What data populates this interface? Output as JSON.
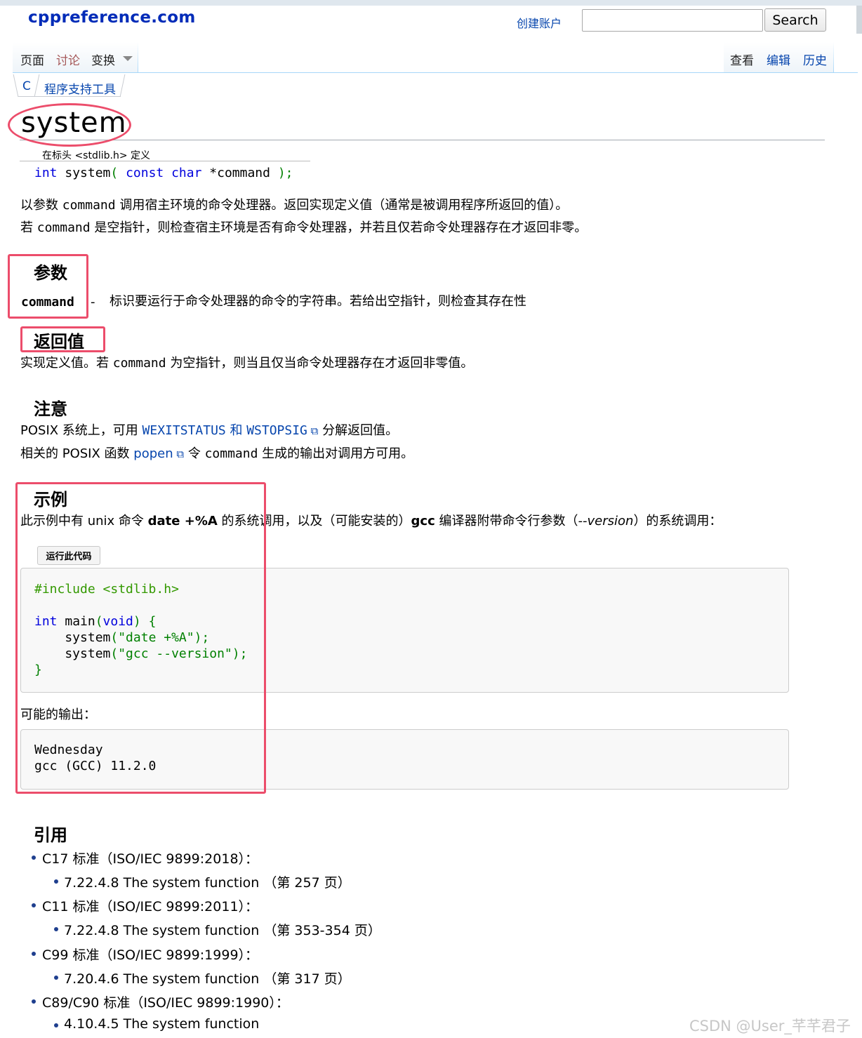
{
  "header": {
    "logo": "cppreference.com",
    "create_account": "创建账户",
    "search_placeholder": "",
    "search_button": "Search"
  },
  "tabs": {
    "page": "页面",
    "discussion": "讨论",
    "variants": "变换",
    "view": "查看",
    "edit": "编辑",
    "history": "历史"
  },
  "breadcrumb": [
    "C",
    "程序支持工具"
  ],
  "page_title": "system",
  "declaration": {
    "defined_in": "在标头 <stdlib.h> 定义",
    "tok_int": "int",
    "tok_name": " system",
    "tok_open": "( ",
    "tok_const": "const",
    "tok_sp": " ",
    "tok_char": "char",
    "tok_param": " *command ",
    "tok_close": ");"
  },
  "description": {
    "line1_a": "以参数 ",
    "line1_code": "command",
    "line1_b": " 调用宿主环境的命令处理器。返回实现定义值（通常是被调用程序所返回的值）。",
    "line2_a": "若 ",
    "line2_code": "command",
    "line2_b": " 是空指针，则检查宿主环境是否有命令处理器，并若且仅若命令处理器存在才返回非零。"
  },
  "params": {
    "heading": "参数",
    "name": "command",
    "dash": "-",
    "desc": "标识要运行于命令处理器的命令的字符串。若给出空指针，则检查其存在性"
  },
  "return_value": {
    "heading": "返回值",
    "text_a": "实现定义值。若 ",
    "text_code": "command",
    "text_b": " 为空指针，则当且仅当命令处理器存在才返回非零值。"
  },
  "notes": {
    "heading": "注意",
    "line1_a": "POSIX 系统上，可用 ",
    "line1_link1": "WEXITSTATUS",
    "line1_and": " 和 ",
    "line1_link2": "WSTOPSIG",
    "line1_b": " 分解返回值。",
    "line2_a": "相关的 POSIX 函数 ",
    "line2_link": "popen",
    "line2_b": " 令 ",
    "line2_code": "command",
    "line2_c": " 生成的输出对调用方可用。"
  },
  "example": {
    "heading": "示例",
    "intro_a": "此示例中有 unix 命令 ",
    "intro_bold1": "date +%A",
    "intro_b": " 的系统调用，以及（可能安装的）",
    "intro_bold2": "gcc",
    "intro_c": " 编译器附带命令行参数（",
    "intro_ital": "--version",
    "intro_d": "）的系统调用：",
    "run_button": "运行此代码",
    "code": {
      "include": "#include <stdlib.h>",
      "l2_int": "int",
      "l2_main": " main",
      "l2_open": "(",
      "l2_void": "void",
      "l2_close": ")",
      "l2_brace": " {",
      "l3_fn": "    system",
      "l3_open": "(",
      "l3_str": "\"date +%A\"",
      "l3_close": ");",
      "l4_fn": "    system",
      "l4_open": "(",
      "l4_str": "\"gcc --version\"",
      "l4_close": ");",
      "l5": "}"
    },
    "output_label": "可能的输出：",
    "output_lines": [
      "Wednesday",
      "gcc (GCC) 11.2.0"
    ]
  },
  "references": {
    "heading": "引用",
    "items": [
      {
        "std": "C17 标准（ISO/IEC 9899:2018）：",
        "sub": "7.22.4.8 The system function （第 257 页）"
      },
      {
        "std": "C11 标准（ISO/IEC 9899:2011）：",
        "sub": "7.22.4.8 The system function （第 353-354 页）"
      },
      {
        "std": "C99 标准（ISO/IEC 9899:1999）：",
        "sub": "7.20.4.6 The system function （第 317 页）"
      },
      {
        "std": "C89/C90 标准（ISO/IEC 9899:1990）：",
        "sub": "4.10.4.5 The system function"
      }
    ]
  },
  "watermark": "CSDN @User_芊芊君子",
  "colors": {
    "annotation": "#ec4d6b",
    "link": "#0645ad",
    "keyword": "#0000dd"
  }
}
